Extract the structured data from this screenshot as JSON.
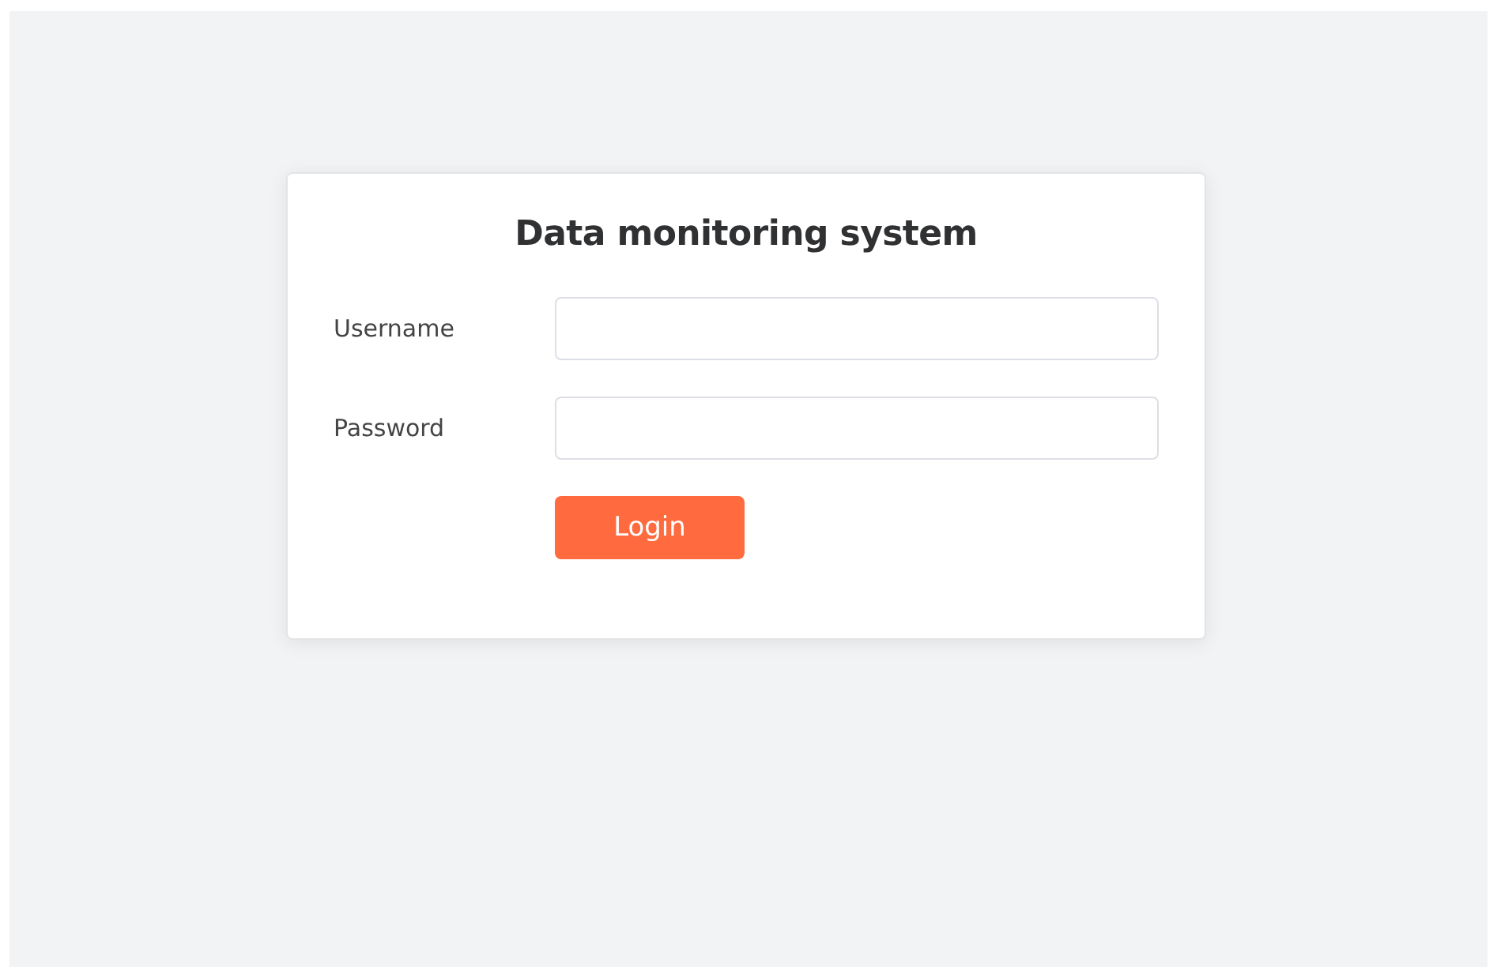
{
  "login_card": {
    "title": "Data monitoring system",
    "fields": [
      {
        "label": "Username"
      },
      {
        "label": "Password"
      }
    ],
    "button": "Login"
  }
}
